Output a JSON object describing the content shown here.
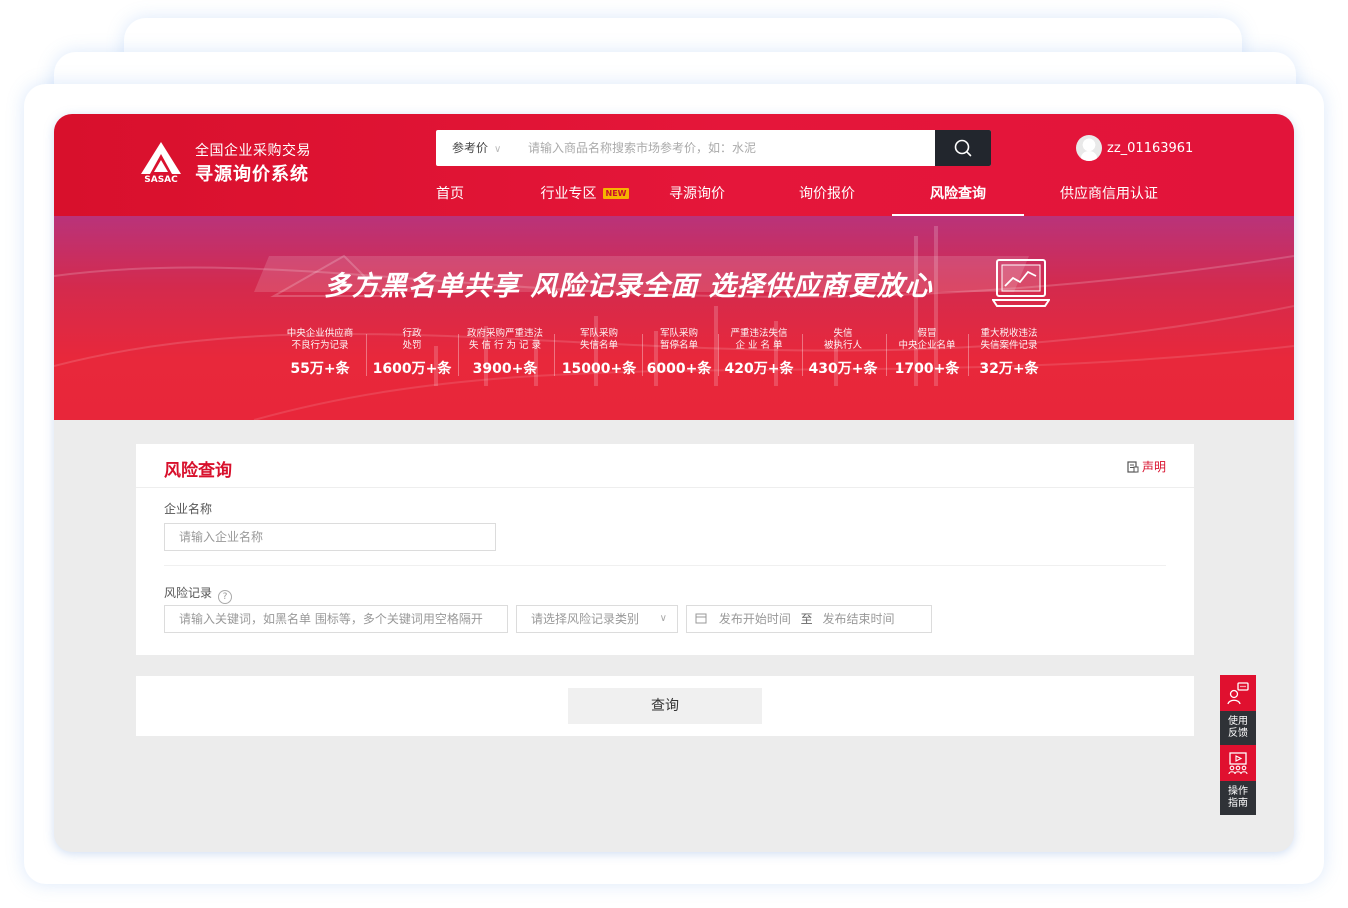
{
  "header": {
    "logo_text": "SASAC",
    "logo_line1": "全国企业采购交易",
    "logo_line2": "寻源询价系统",
    "search": {
      "type_label": "参考价",
      "placeholder": "请输入商品名称搜索市场参考价，如：水泥"
    },
    "username": "zz_01163961",
    "nav": [
      {
        "label": "首页"
      },
      {
        "label": "行业专区",
        "badge": "NEW"
      },
      {
        "label": "寻源询价"
      },
      {
        "label": "询价报价"
      },
      {
        "label": "风险查询",
        "active": true
      },
      {
        "label": "供应商信用认证"
      }
    ]
  },
  "banner": {
    "slogan": "多方黑名单共享  风险记录全面  选择供应商更放心",
    "stats": [
      {
        "label": "中央企业供应商\n不良行为记录",
        "value": "55万+条"
      },
      {
        "label": "行政\n处罚",
        "value": "1600万+条"
      },
      {
        "label": "政府采购严重违法\n失 信 行 为 记 录",
        "value": "3900+条"
      },
      {
        "label": "军队采购\n失信名单",
        "value": "15000+条"
      },
      {
        "label": "军队采购\n暂停名单",
        "value": "6000+条"
      },
      {
        "label": "严重违法失信\n企 业 名 单",
        "value": "420万+条"
      },
      {
        "label": "失信\n被执行人",
        "value": "430万+条"
      },
      {
        "label": "假冒\n中央企业名单",
        "value": "1700+条"
      },
      {
        "label": "重大税收违法\n失信案件记录",
        "value": "32万+条"
      }
    ]
  },
  "panel": {
    "title": "风险查询",
    "declare_label": "声明",
    "company_label": "企业名称",
    "company_placeholder": "请输入企业名称",
    "risk_label": "风险记录",
    "keyword_placeholder": "请输入关键词，如黑名单 围标等，多个关键词用空格隔开",
    "category_placeholder": "请选择风险记录类别",
    "date_start": "发布开始时间",
    "date_sep": "至",
    "date_end": "发布结束时间",
    "query_button": "查询"
  },
  "float": {
    "feedback_label": "使用\n反馈",
    "guide_label": "操作\n指南"
  },
  "colors": {
    "brand_red": "#d8102c",
    "dark": "#22262d"
  }
}
